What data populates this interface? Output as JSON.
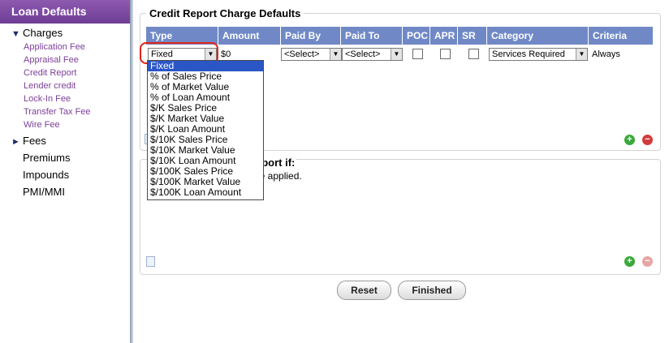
{
  "sidebar": {
    "title": "Loan Defaults",
    "charges": {
      "label": "Charges",
      "items": [
        "Application Fee",
        "Appraisal Fee",
        "Credit Report",
        "Lender credit",
        "Lock-In Fee",
        "Transfer Tax Fee",
        "Wire Fee"
      ]
    },
    "fees_label": "Fees",
    "other_items": [
      "Premiums",
      "Impounds",
      "PMI/MMI"
    ]
  },
  "section": {
    "title": "Credit Report Charge Defaults",
    "columns": [
      "Type",
      "Amount",
      "Paid By",
      "Paid To",
      "POC",
      "APR",
      "SR",
      "Category",
      "Criteria"
    ],
    "row": {
      "type": "Fixed",
      "amount": "$0",
      "paid_by": "<Select>",
      "paid_to": "<Select>",
      "category": "Services Required",
      "criteria": "Always"
    },
    "type_options": [
      "Fixed",
      "% of Sales Price",
      "% of Market Value",
      "% of Loan Amount",
      "$/K Sales Price",
      "$/K Market Value",
      "$/K Loan Amount",
      "$/10K Sales Price",
      "$/10K Market Value",
      "$/10K Loan Amount",
      "$/100K Sales Price",
      "$/100K Market Value",
      "$/100K Loan Amount"
    ]
  },
  "bottom": {
    "heading": "eport if:",
    "text": "be applied."
  },
  "buttons": {
    "reset": "Reset",
    "finished": "Finished"
  },
  "colors": {
    "sidebar_header": "#7b4aa0",
    "table_header": "#7089c6",
    "highlight": "#e2231a",
    "selected_option": "#2a56c6"
  }
}
